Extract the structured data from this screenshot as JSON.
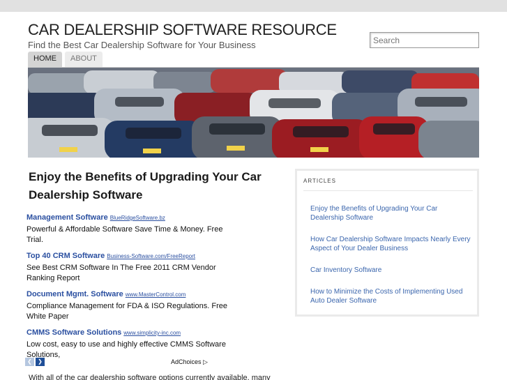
{
  "site": {
    "title": "CAR DEALERSHIP SOFTWARE RESOURCE",
    "description": "Find the Best Car Dealership Software for Your Business"
  },
  "search": {
    "placeholder": "Search"
  },
  "nav": {
    "tabs": [
      {
        "label": "HOME"
      },
      {
        "label": "ABOUT"
      }
    ]
  },
  "post": {
    "title": "Enjoy the Benefits of Upgrading Your Car Dealership Software",
    "intro": "With all of the car dealership software options currently available, many"
  },
  "ads": [
    {
      "headline": "Management Software",
      "url": "BlueRidgeSoftware.bz",
      "text": "Powerful & Affordable Software Save Time & Money. Free Trial."
    },
    {
      "headline": "Top 40 CRM Software",
      "url": "Business-Software.com/FreeReport",
      "text": "See Best CRM Software In The Free 2011 CRM Vendor Ranking Report"
    },
    {
      "headline": "Document Mgmt. Software",
      "url": "www.MasterControl.com",
      "text": "Compliance Management for FDA & ISO Regulations. Free White Paper"
    },
    {
      "headline": "CMMS Software Solutions",
      "url": "www.simplicity-inc.com",
      "text": "Low cost, easy to use and highly effective CMMS Software Solutions,"
    }
  ],
  "ad_controls": {
    "prev": "❮",
    "next": "❯",
    "adchoices": "AdChoices ▷"
  },
  "sidebar": {
    "title": "ARTICLES",
    "items": [
      {
        "label": "Enjoy the Benefits of Upgrading Your Car Dealership Software"
      },
      {
        "label": "How Car Dealership Software Impacts Nearly Every Aspect of Your Dealer Business"
      },
      {
        "label": "Car Inventory Software"
      },
      {
        "label": "How to Minimize the Costs of Implementing Used Auto Dealer Software"
      }
    ]
  },
  "banner": {
    "image": "parking-lot-cars-photo"
  },
  "colors": {
    "link": "#3b66ad",
    "ad_link": "#2a4fa0",
    "topbar": "#e1e1e1"
  }
}
